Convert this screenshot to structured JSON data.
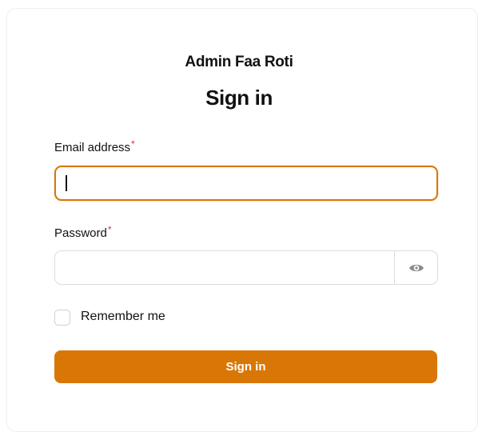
{
  "app": {
    "title": "Admin Faa Roti"
  },
  "form": {
    "heading": "Sign in",
    "required_mark": "*",
    "email": {
      "label": "Email address",
      "value": "",
      "placeholder": ""
    },
    "password": {
      "label": "Password",
      "value": "",
      "placeholder": "",
      "toggle_icon": "eye-icon"
    },
    "remember": {
      "label": "Remember me",
      "checked": false
    },
    "submit_label": "Sign in"
  },
  "colors": {
    "accent": "#d97706",
    "required": "#e03131",
    "border": "#d9d9d9",
    "text": "#111111"
  }
}
